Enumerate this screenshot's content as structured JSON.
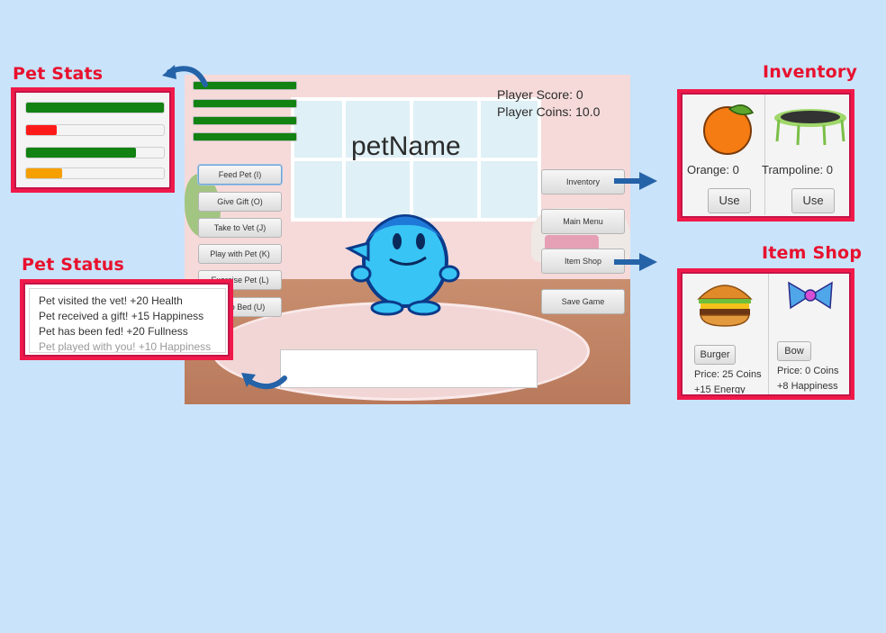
{
  "callouts": {
    "pet_stats": "Pet Stats",
    "pet_status": "Pet Status",
    "inventory": "Inventory",
    "item_shop": "Item Shop"
  },
  "pet_stats_bars": [
    {
      "level": 1.0,
      "color": "#128212"
    },
    {
      "level": 0.22,
      "color": "#ff1a1a"
    },
    {
      "level": 0.8,
      "color": "#128212"
    },
    {
      "level": 0.26,
      "color": "#f59f00"
    }
  ],
  "game": {
    "pet_name": "petName",
    "player_score": "Player Score: 0",
    "player_coins": "Player Coins: 10.0",
    "stat_bars": [
      1.0,
      1.0,
      1.0,
      1.0
    ],
    "left_buttons": [
      {
        "label": "Feed Pet (I)"
      },
      {
        "label": "Give Gift (O)"
      },
      {
        "label": "Take to Vet (J)"
      },
      {
        "label": "Play with Pet (K)"
      },
      {
        "label": "Exercise Pet (L)"
      },
      {
        "label": "Go to Bed (U)"
      }
    ],
    "right_buttons": [
      {
        "label": "Inventory"
      },
      {
        "label": "Main Menu"
      },
      {
        "label": "Item Shop"
      },
      {
        "label": "Save Game"
      }
    ],
    "message_box": ""
  },
  "status_log": [
    "Pet visited the vet! +20 Health",
    "Pet received a gift! +15 Happiness",
    "Pet has been fed! +20 Fullness",
    "Pet played with you! +10 Happiness"
  ],
  "inventory": {
    "items": [
      {
        "name": "Orange: 0",
        "button": "Use",
        "icon": "orange-icon"
      },
      {
        "name": "Trampoline: 0",
        "button": "Use",
        "icon": "trampoline-icon"
      }
    ]
  },
  "shop": {
    "items": [
      {
        "button": "Burger",
        "price": "Price: 25 Coins",
        "effect": "+15 Energy",
        "icon": "burger-icon"
      },
      {
        "button": "Bow",
        "price": "Price: 0 Coins",
        "effect": "+8 Happiness",
        "icon": "bow-icon"
      }
    ]
  },
  "colors": {
    "background": "#c9e3fb",
    "callout_red": "#e8112d",
    "arrow_blue": "#2563a8",
    "pet_blue": "#2fb6ee"
  }
}
